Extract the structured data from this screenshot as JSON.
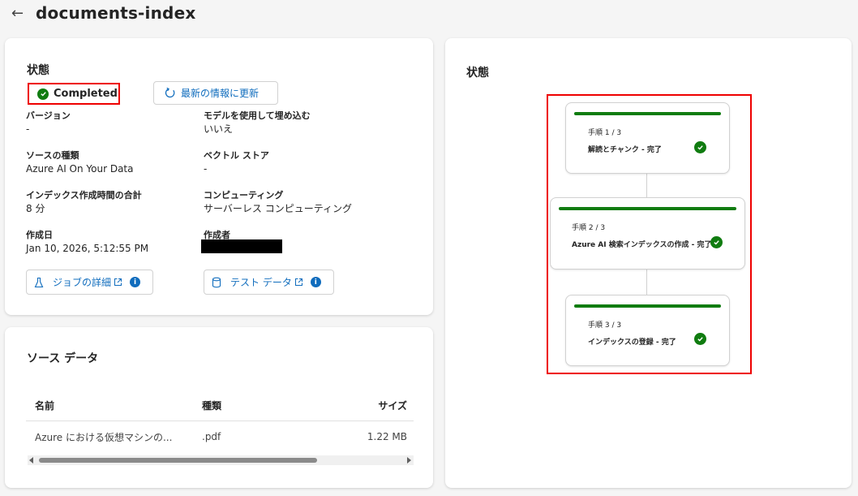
{
  "header": {
    "title": "documents-index"
  },
  "status_card": {
    "title": "状態",
    "status": "Completed",
    "refresh_label": "最新の情報に更新",
    "fields": [
      {
        "label": "バージョン",
        "value": "-"
      },
      {
        "label": "モデルを使用して埋め込む",
        "value": "いいえ"
      },
      {
        "label": "ソースの種類",
        "value": "Azure AI On Your Data"
      },
      {
        "label": "ベクトル ストア",
        "value": "-"
      },
      {
        "label": "インデックス作成時間の合計",
        "value": "8 分"
      },
      {
        "label": "コンピューティング",
        "value": "サーバーレス コンピューティング"
      },
      {
        "label": "作成日",
        "value": "Jan 10, 2026, 5:12:55 PM"
      },
      {
        "label": "作成者",
        "value": ""
      }
    ],
    "job_details_label": "ジョブの詳細",
    "test_data_label": "テスト データ"
  },
  "source_card": {
    "title": "ソース データ",
    "columns": [
      "名前",
      "種類",
      "サイズ"
    ],
    "rows": [
      {
        "name": "Azure における仮想マシンの...",
        "type": ".pdf",
        "size": "1.22 MB"
      }
    ]
  },
  "steps_card": {
    "title": "状態",
    "steps": [
      {
        "number": "手順 1 / 3",
        "name": "解読とチャンク - 完了"
      },
      {
        "number": "手順 2 / 3",
        "name": "Azure AI 検索インデックスの作成 - 完了"
      },
      {
        "number": "手順 3 / 3",
        "name": "インデックスの登録 - 完了"
      }
    ]
  },
  "colors": {
    "accent": "#0f6cbd",
    "success": "#107c10",
    "highlight": "#ee0000"
  },
  "icons": [
    "back-arrow-icon",
    "check-circle-icon",
    "refresh-icon",
    "beaker-icon",
    "database-icon",
    "external-link-icon",
    "info-icon"
  ]
}
